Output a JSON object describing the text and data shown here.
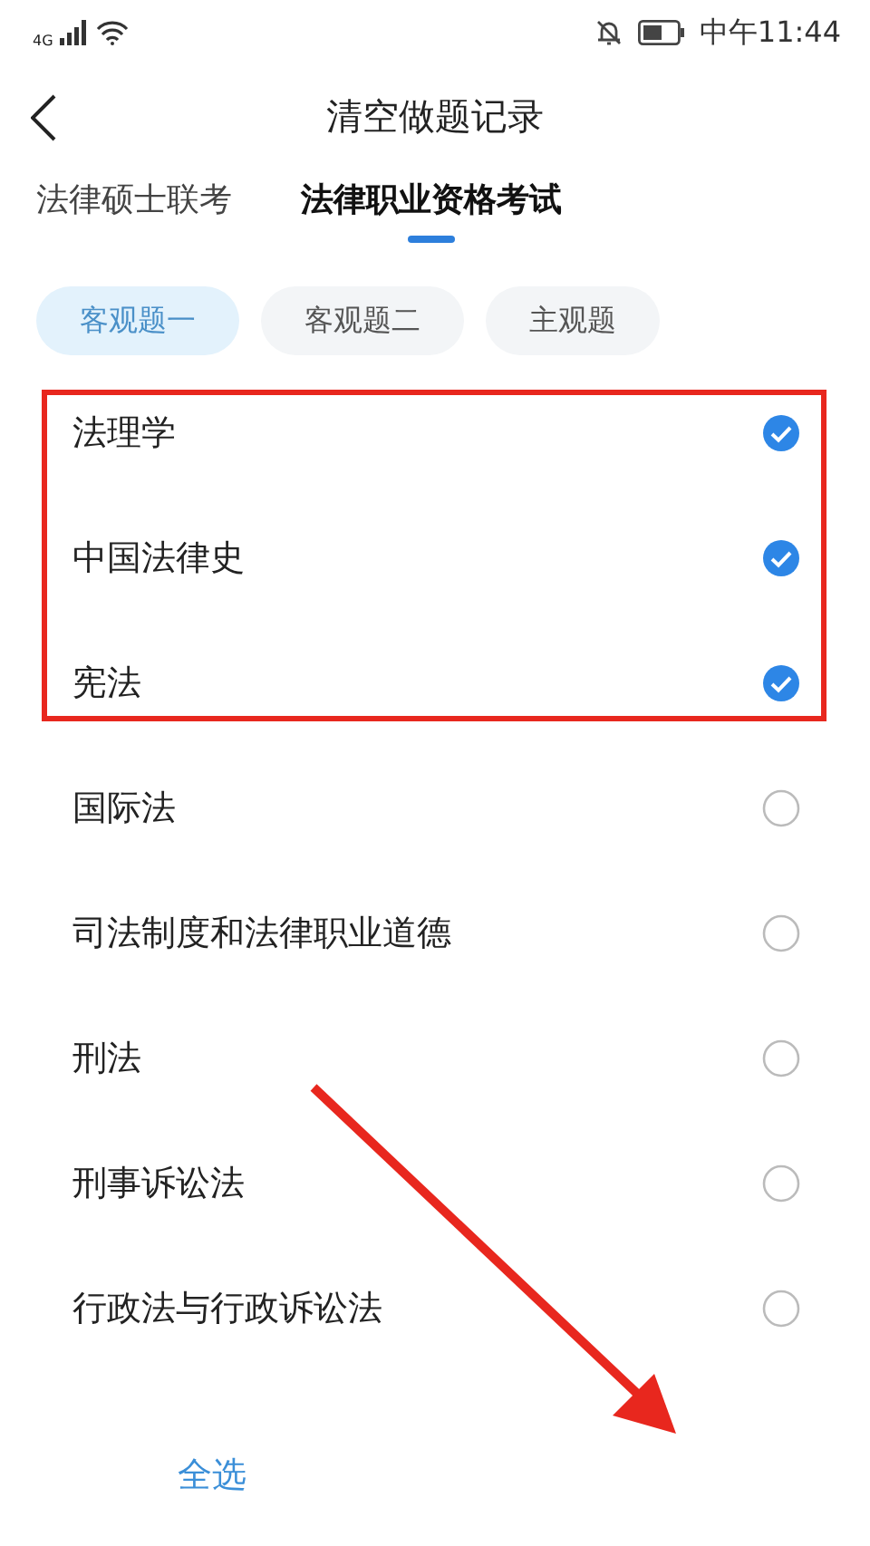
{
  "status_bar": {
    "network": "4G",
    "time": "中午11:44"
  },
  "header": {
    "title": "清空做题记录"
  },
  "tabs": [
    {
      "label": "法律硕士联考",
      "selected": false
    },
    {
      "label": "法律职业资格考试",
      "selected": true
    }
  ],
  "chips": [
    {
      "label": "客观题一",
      "selected": true
    },
    {
      "label": "客观题二",
      "selected": false
    },
    {
      "label": "主观题",
      "selected": false
    }
  ],
  "subjects": [
    {
      "name": "法理学",
      "checked": true
    },
    {
      "name": "中国法律史",
      "checked": true
    },
    {
      "name": "宪法",
      "checked": true
    },
    {
      "name": "国际法",
      "checked": false
    },
    {
      "name": "司法制度和法律职业道德",
      "checked": false
    },
    {
      "name": "刑法",
      "checked": false
    },
    {
      "name": "刑事诉讼法",
      "checked": false
    },
    {
      "name": "行政法与行政诉讼法",
      "checked": false
    }
  ],
  "bottom_bar": {
    "select_all": "全选"
  }
}
